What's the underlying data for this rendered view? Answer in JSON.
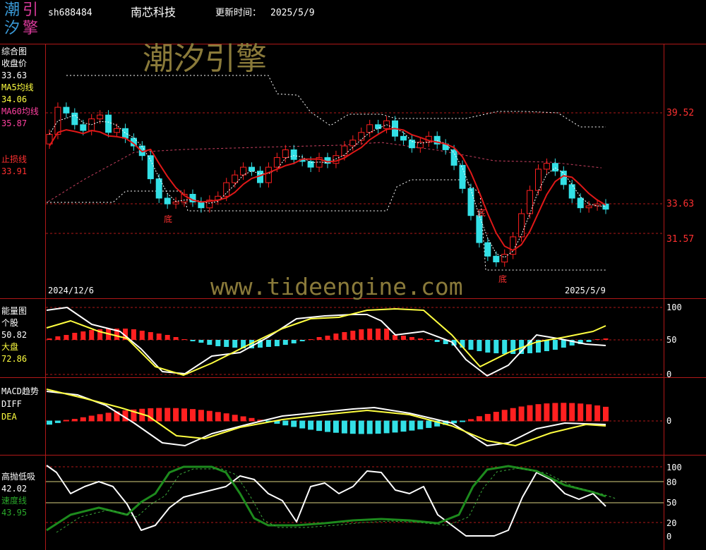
{
  "header": {
    "logo_chars": [
      "潮",
      "引",
      "汐",
      "擎"
    ],
    "code": "sh688484",
    "name": "南芯科技",
    "update_label": "更新时间：",
    "update_date": "2025/5/9"
  },
  "watermark": {
    "text": "潮汐引擎",
    "url": "www.tideengine.com"
  },
  "main_panel": {
    "title": "综合图",
    "close_label": "收盘价",
    "close_value": "33.63",
    "ma5_label": "MA5均线",
    "ma5_value": "34.06",
    "ma60_label": "MA60均线",
    "ma60_value": "35.87",
    "stop_label": "止损线",
    "stop_value": "33.91",
    "axis": [
      "39.52",
      "33.63",
      "31.57"
    ],
    "date_start": "2024/12/6",
    "date_end": "2025/5/9",
    "bottom_markers": [
      "底",
      "底",
      "底"
    ]
  },
  "energy_panel": {
    "title": "能量图",
    "stock_label": "个股",
    "stock_value": "50.82",
    "market_label": "大盘",
    "market_value": "72.86",
    "axis": [
      "100",
      "50",
      "0"
    ]
  },
  "macd_panel": {
    "title": "MACD趋势",
    "diff_label": "DIFF",
    "dea_label": "DEA",
    "axis": [
      "0"
    ]
  },
  "gdxz_panel": {
    "title": "高抛低吸",
    "value": "42.02",
    "speed_label": "速度线",
    "speed_value": "43.95",
    "axis": [
      "100",
      "80",
      "50",
      "20",
      "0"
    ]
  },
  "colors": {
    "up": "#ff2020",
    "down": "#33e0e6",
    "ma60": "#e01818",
    "white": "#ffffff",
    "yellow": "#ffff40",
    "green": "#1d8a1d",
    "grid": "#b01818",
    "watermark": "#8a7a3a"
  },
  "chart_data": [
    {
      "type": "candlestick",
      "title": "综合图",
      "x_range": [
        "2024/12/6",
        "2025/5/9"
      ],
      "y_ticks": [
        39.52,
        33.63,
        31.57
      ],
      "series": [
        {
          "name": "收盘价",
          "last": 33.63
        },
        {
          "name": "MA5均线",
          "last": 34.06
        },
        {
          "name": "MA60均线",
          "last": 35.87
        },
        {
          "name": "止损线",
          "last": 33.91
        }
      ],
      "close_path": [
        37.5,
        38.9,
        38.6,
        38.0,
        37.7,
        38.3,
        38.5,
        37.6,
        37.8,
        37.3,
        36.9,
        36.4,
        35.2,
        34.2,
        33.9,
        34.0,
        34.4,
        34.0,
        33.7,
        34.1,
        34.3,
        35.0,
        35.4,
        35.8,
        35.6,
        35.0,
        35.8,
        36.3,
        36.7,
        36.2,
        36.1,
        35.8,
        36.3,
        36.0,
        36.4,
        36.9,
        37.2,
        37.6,
        38.0,
        37.8,
        38.2,
        37.4,
        37.2,
        36.8,
        37.1,
        37.4,
        37.0,
        36.7,
        35.9,
        34.7,
        33.3,
        31.9,
        31.2,
        30.9,
        31.3,
        32.2,
        33.4,
        34.6,
        35.7,
        36.0,
        35.6,
        34.9,
        34.2,
        33.7,
        33.8,
        33.9,
        33.63
      ],
      "ylim": [
        30.3,
        40.8
      ]
    },
    {
      "type": "line",
      "title": "能量图",
      "series": [
        {
          "name": "个股",
          "last": 50.82
        },
        {
          "name": "大盘",
          "last": 72.86
        }
      ],
      "ylim": [
        0,
        100
      ]
    },
    {
      "type": "line",
      "title": "MACD趋势",
      "series": [
        {
          "name": "DIFF"
        },
        {
          "name": "DEA"
        }
      ],
      "y_ticks": [
        0
      ]
    },
    {
      "type": "line",
      "title": "高抛低吸",
      "series": [
        {
          "name": "高抛低吸",
          "last": 42.02
        },
        {
          "name": "速度线",
          "last": 43.95
        }
      ],
      "y_ticks": [
        100,
        80,
        50,
        20,
        0
      ],
      "ylim": [
        0,
        100
      ]
    }
  ]
}
